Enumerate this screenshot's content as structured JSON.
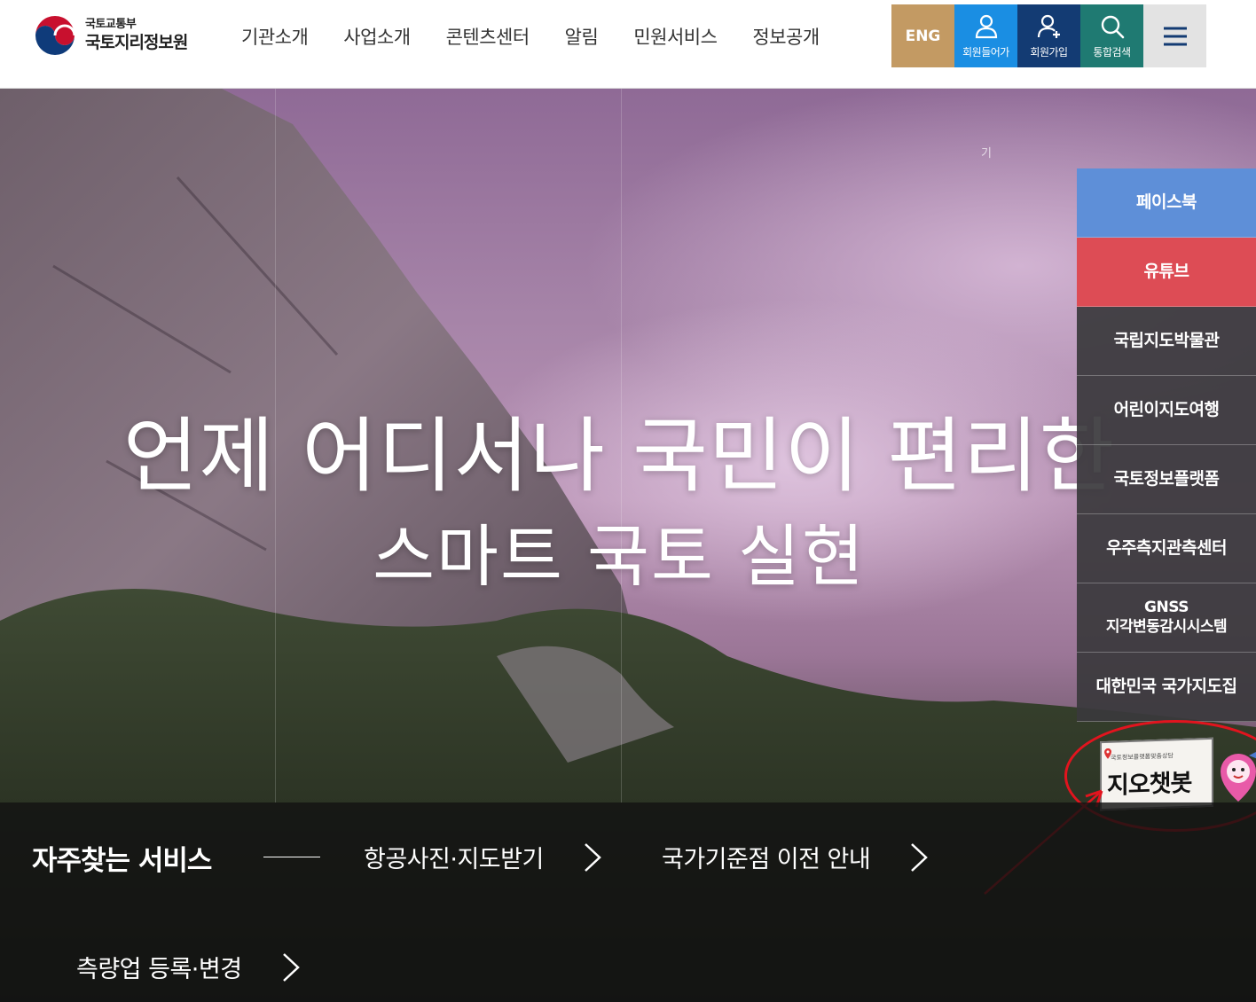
{
  "header": {
    "logo": {
      "ministry": "국토교통부",
      "agency": "국토지리정보원"
    },
    "nav": [
      "기관소개",
      "사업소개",
      "콘텐츠센터",
      "알림",
      "민원서비스",
      "정보공개"
    ],
    "util": {
      "eng": "ENG",
      "login": "회원들어가",
      "join": "회원가입",
      "search": "통합검색"
    }
  },
  "hero": {
    "marker": "기",
    "slogan_line1": "언제 어디서나 국민이 편리한",
    "slogan_line2": "스마트 국토 실현"
  },
  "side_panel": {
    "items": [
      "페이스북",
      "유튜브",
      "국립지도박물관",
      "어린이지도여행",
      "국토정보플랫폼",
      "우주측지관측센터"
    ],
    "gnss_line1": "GNSS",
    "gnss_line2": "지각변동감시시스템",
    "atlas": "대한민국 국가지도집"
  },
  "chatbot": {
    "subtitle": "국토정보플랫폼맞춤상담",
    "title": "지오챗봇"
  },
  "quick_services": {
    "title": "자주찾는 서비스",
    "links": [
      "항공사진·지도받기",
      "국가기준점 이전 안내",
      "측량업 등록·변경"
    ]
  },
  "colors": {
    "eng": "#c39a63",
    "login": "#1a8ee3",
    "join": "#133b73",
    "search": "#1f7a72",
    "facebook": "#5e8fd8",
    "youtube": "#dd4c55",
    "annotation": "#e2141e"
  },
  "icons": {
    "login": "person-icon",
    "join": "person-add-icon",
    "search": "search-icon",
    "menu": "hamburger-icon",
    "link_arrow": "chevron-right-icon"
  }
}
